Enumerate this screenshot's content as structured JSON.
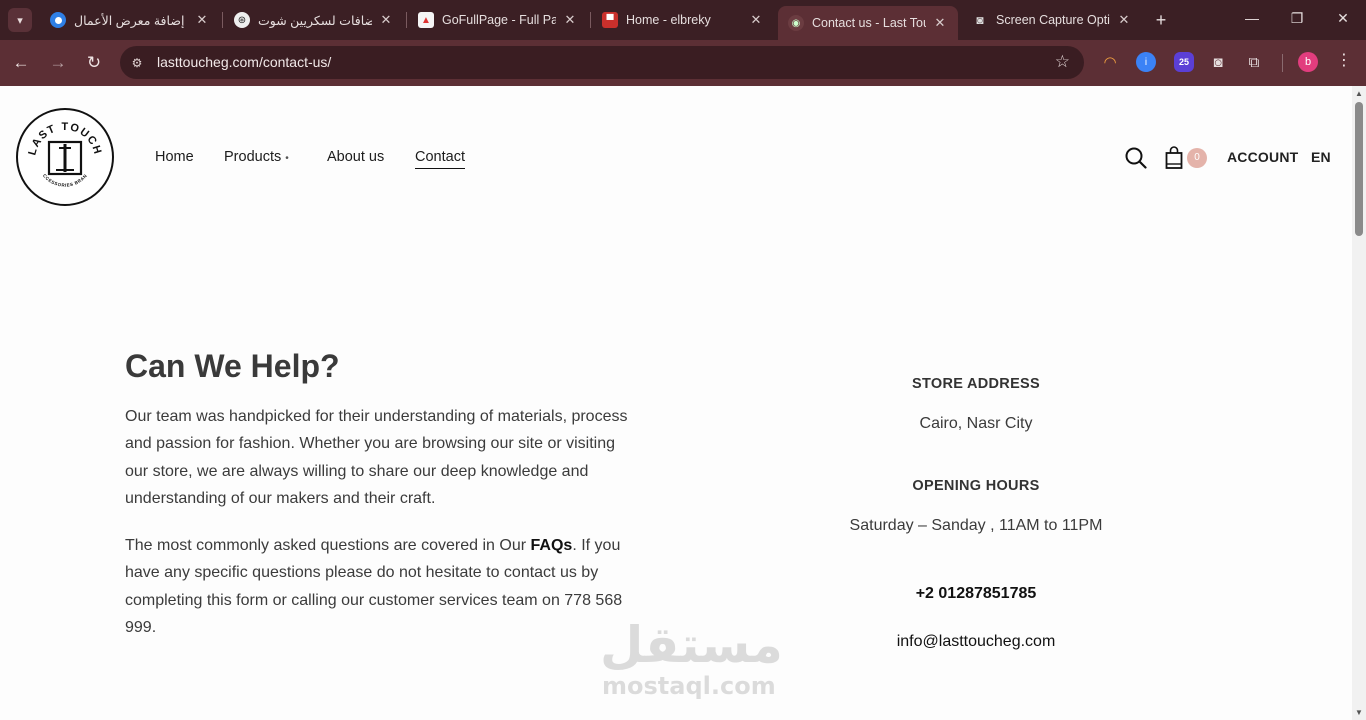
{
  "browser": {
    "tabs": [
      {
        "title": "إضافة معرض الأعمال |",
        "favicon": "circle-logo-icon"
      },
      {
        "title": "إضافات لسكريين شوت",
        "favicon": "openai-icon"
      },
      {
        "title": "GoFullPage - Full Page",
        "favicon": "gofullpage-icon"
      },
      {
        "title": "Home - elbreky",
        "favicon": "elbreky-icon"
      },
      {
        "title": "Contact us - Last Touch",
        "favicon": "lasttouch-icon"
      },
      {
        "title": "Screen Capture Optio",
        "favicon": "camera-icon"
      }
    ],
    "active_tab": 4,
    "url": "lasttoucheg.com/contact-us/",
    "extension_badge": "25",
    "profile_initial": "b"
  },
  "site": {
    "logo_text": "LAST TOUCH",
    "logo_subtext": "ACCESSORIES BRAND",
    "nav": {
      "home": "Home",
      "products": "Products",
      "about": "About us",
      "contact": "Contact"
    },
    "cart_count": "0",
    "account": "ACCOUNT",
    "language": "EN"
  },
  "content": {
    "heading": "Can We Help?",
    "para1": "Our team was handpicked for their understanding of materials, process and passion for fashion. Whether you are browsing our site or visiting our store, we are always willing to share our deep knowledge and understanding of our makers and their craft.",
    "para2_before": "The most commonly asked questions are covered in Our ",
    "para2_link": "FAQs",
    "para2_after": ". If you have any specific questions please do not hesitate to contact us by completing this form or calling our customer services team on 778 568 999.",
    "store_address_title": "STORE ADDRESS",
    "store_address": "Cairo, Nasr City",
    "opening_hours_title": "OPENING HOURS",
    "opening_hours": "Saturday – Sanday , 11AM to 11PM",
    "phone": "+2 01287851785",
    "email": "info@lasttoucheg.com"
  },
  "watermark": {
    "arabic": "مستقل",
    "latin": "mostaql.com"
  },
  "colors": {
    "tabbar": "#3b1f24",
    "toolbar": "#5c2f35",
    "cart_badge": "#e4b3aa"
  }
}
